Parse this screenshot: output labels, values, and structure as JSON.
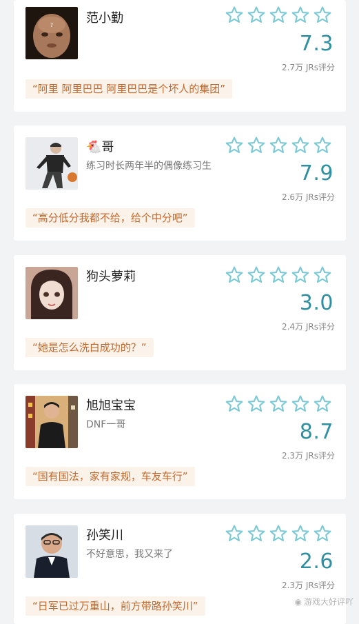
{
  "colors": {
    "score": "#2f8fa0",
    "quote_text": "#c4682e",
    "quote_bg": "#fbf3e9",
    "star": "#7cc9d6"
  },
  "cards": [
    {
      "name": "范小勤",
      "subtitle": "",
      "score": "7.3",
      "count": "2.7万 JRs评分",
      "quote": "“阿里 阿里巴巴 阿里巴巴是个坏人的集团”",
      "stars_filled": 0,
      "stars_total": 5
    },
    {
      "name": "🐔哥",
      "subtitle": "练习时长两年半的偶像练习生",
      "score": "7.9",
      "count": "2.6万 JRs评分",
      "quote": "“高分低分我都不给，给个中分吧”",
      "stars_filled": 0,
      "stars_total": 5
    },
    {
      "name": "狗头萝莉",
      "subtitle": "",
      "score": "3.0",
      "count": "2.4万 JRs评分",
      "quote": "“她是怎么洗白成功的？”",
      "stars_filled": 0,
      "stars_total": 5
    },
    {
      "name": "旭旭宝宝",
      "subtitle": "DNF一哥",
      "score": "8.7",
      "count": "2.3万 JRs评分",
      "quote": "“国有国法，家有家规，车友车行”",
      "stars_filled": 0,
      "stars_total": 5
    },
    {
      "name": "孙笑川",
      "subtitle": "不好意思，我又来了",
      "score": "2.6",
      "count": "2.3万 JRs评分",
      "quote": "“日军已过万重山，前方带路孙笑川”",
      "stars_filled": 0,
      "stars_total": 5
    }
  ],
  "watermark": "游戏大好评吖"
}
